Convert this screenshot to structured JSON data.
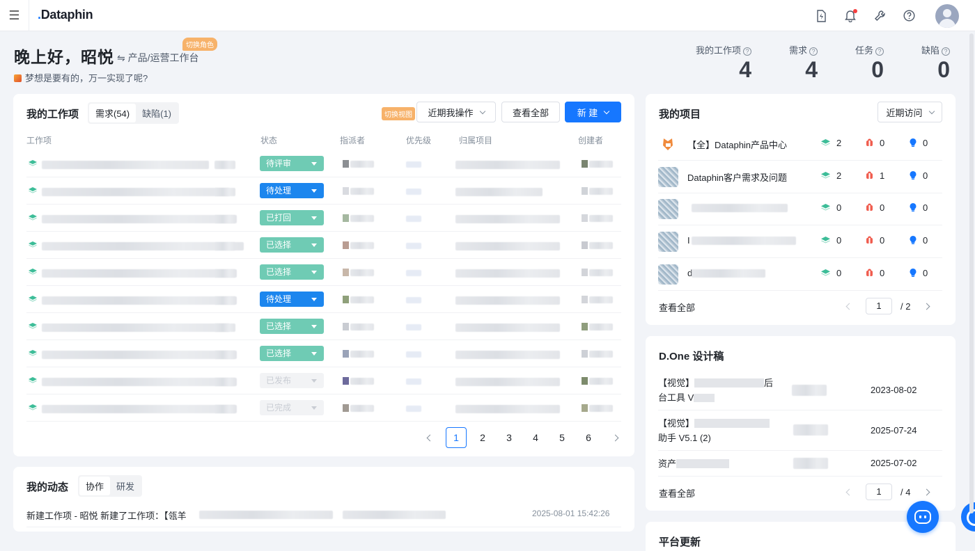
{
  "app": {
    "logo": "Dataphin"
  },
  "header": {
    "greeting": "晚上好，昭悦",
    "workspace": "⇋ 产品/运营工作台",
    "role_badge": "切换角色",
    "motto": "梦想是要有的，万一实现了呢?"
  },
  "stats": [
    {
      "label": "我的工作项",
      "value": "4"
    },
    {
      "label": "需求",
      "value": "4"
    },
    {
      "label": "任务",
      "value": "0"
    },
    {
      "label": "缺陷",
      "value": "0"
    }
  ],
  "workitems": {
    "title": "我的工作项",
    "tabs": [
      "需求(54)",
      "缺陷(1)"
    ],
    "view_badge": "切换视图",
    "filter": "近期我操作",
    "view_all": "查看全部",
    "new_label": "新 建",
    "columns": [
      "工作项",
      "状态",
      "指派者",
      "优先级",
      "归属项目",
      "创建者"
    ],
    "rows": [
      {
        "status": "待评审",
        "kind": "green"
      },
      {
        "status": "待处理",
        "kind": "blue"
      },
      {
        "status": "已打回",
        "kind": "green"
      },
      {
        "status": "已选择",
        "kind": "green"
      },
      {
        "status": "已选择",
        "kind": "green"
      },
      {
        "status": "待处理",
        "kind": "blue"
      },
      {
        "status": "已选择",
        "kind": "green"
      },
      {
        "status": "已选择",
        "kind": "green"
      },
      {
        "status": "已发布",
        "kind": "gray"
      },
      {
        "status": "已完成",
        "kind": "gray"
      }
    ],
    "pages": [
      "1",
      "2",
      "3",
      "4",
      "5",
      "6"
    ],
    "current_page": "1"
  },
  "activity": {
    "title": "我的动态",
    "tabs": [
      "协作",
      "研发"
    ],
    "item_text": "新建工作项 - 昭悦 新建了工作项：【瓴羊",
    "item_time": "2025-08-01 15:42:26"
  },
  "projects": {
    "title": "我的项目",
    "filter": "近期访问",
    "items": [
      {
        "name": "【全】Dataphin产品中心",
        "req": "2",
        "bug": "0",
        "idea": "0"
      },
      {
        "name": "Dataphin客户需求及问题",
        "req": "2",
        "bug": "1",
        "idea": "0"
      },
      {
        "name": "",
        "req": "0",
        "bug": "0",
        "idea": "0"
      },
      {
        "name": "I",
        "req": "0",
        "bug": "0",
        "idea": "0"
      },
      {
        "name": "d",
        "req": "0",
        "bug": "0",
        "idea": "0"
      }
    ],
    "view_all": "查看全部",
    "page": "1",
    "total_pages": "/ 2"
  },
  "designs": {
    "title": "D.One 设计稿",
    "items": [
      {
        "line1": "【视觉】",
        "line1_tail": "后",
        "line2": "台工具 V",
        "date": "2023-08-02"
      },
      {
        "line1": "【视觉】",
        "line1_tail": "",
        "line2": "助手 V5.1 (2)",
        "date": "2025-07-24"
      },
      {
        "line1": "资产",
        "line1_tail": "",
        "line2": "",
        "date": "2025-07-02"
      }
    ],
    "view_all": "查看全部",
    "page": "1",
    "total_pages": "/ 4"
  },
  "updates": {
    "title": "平台更新"
  },
  "colors": {
    "primary": "#1677ff",
    "status_green": "#6fcbb4",
    "status_blue": "#1c86ee",
    "badge_orange": "#f7b26a"
  }
}
